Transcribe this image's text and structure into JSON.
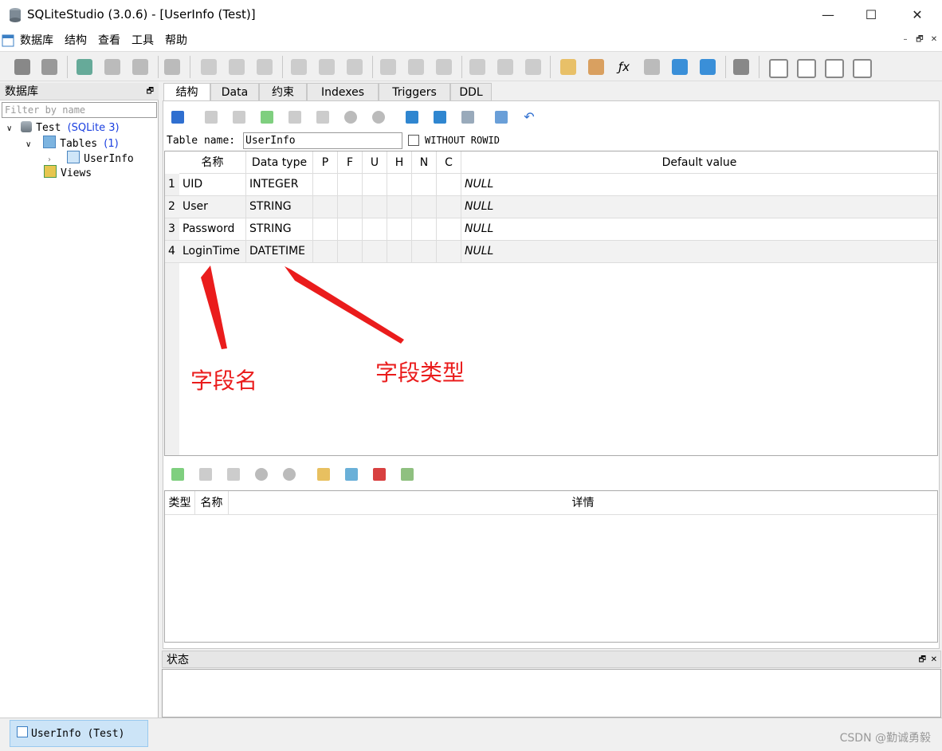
{
  "window": {
    "title": "SQLiteStudio (3.0.6) - [UserInfo (Test)]",
    "minimize": "—",
    "maximize": "☐",
    "close": "✕"
  },
  "menu": [
    "数据库",
    "结构",
    "查看",
    "工具",
    "帮助"
  ],
  "mdi_controls": [
    "–",
    "🗗",
    "✕"
  ],
  "db_panel": {
    "title": "数据库",
    "filter_placeholder": "Filter by name",
    "tree": {
      "db_name": "Test",
      "db_version": "(SQLite 3)",
      "tables_label": "Tables",
      "tables_count": "(1)",
      "table_name": "UserInfo",
      "views_label": "Views"
    }
  },
  "tabs": [
    "结构",
    "Data",
    "约束",
    "Indexes",
    "Triggers",
    "DDL"
  ],
  "table_name_label": "Table name:",
  "table_name_value": "UserInfo",
  "without_rowid_label": "WITHOUT ROWID",
  "columns_header": [
    "名称",
    "Data type",
    "P",
    "F",
    "U",
    "H",
    "N",
    "C",
    "Default value"
  ],
  "rows": [
    {
      "num": "1",
      "name": "UID",
      "type": "INTEGER",
      "default": "NULL"
    },
    {
      "num": "2",
      "name": "User",
      "type": "STRING",
      "default": "NULL"
    },
    {
      "num": "3",
      "name": "Password",
      "type": "STRING",
      "default": "NULL"
    },
    {
      "num": "4",
      "name": "LoginTime",
      "type": "DATETIME",
      "default": "NULL"
    }
  ],
  "annotations": {
    "field_name": "字段名",
    "field_type": "字段类型",
    "color": "#ea1c1c"
  },
  "constraints_header": [
    "类型",
    "名称",
    "详情"
  ],
  "status_title": "状态",
  "taskbar_tab": "UserInfo (Test)",
  "watermark": "CSDN @勤诚勇毅"
}
